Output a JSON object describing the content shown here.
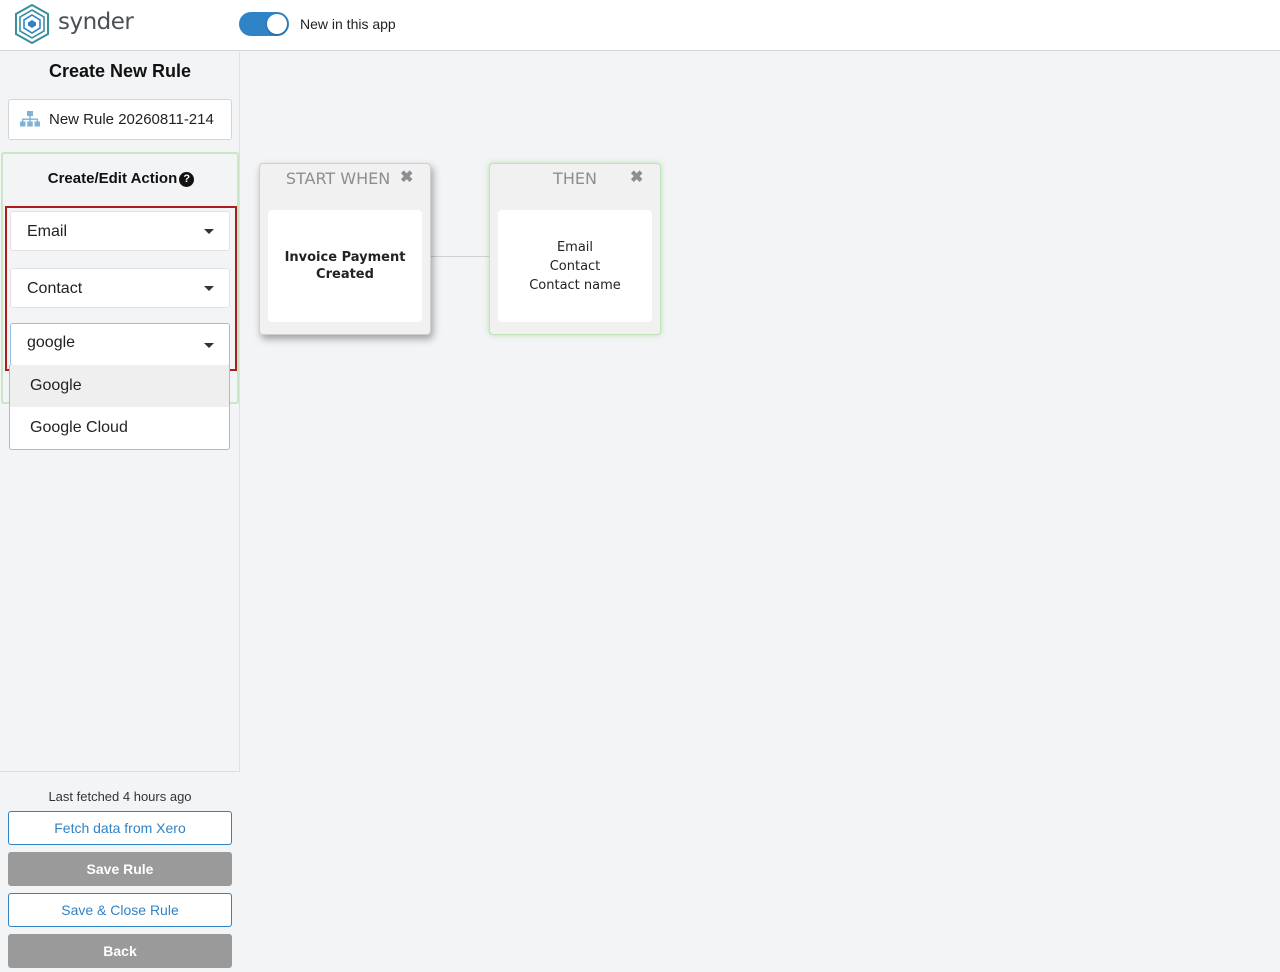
{
  "header": {
    "brand": "synder",
    "toggle_label": "New in this app",
    "toggle_on": true,
    "accent_color": "#2f83c7"
  },
  "sidebar": {
    "title": "Create New Rule",
    "rule_name_value": "New Rule 20260811-214",
    "rule_name_icon": "sitemap-icon",
    "action_panel": {
      "title": "Create/Edit Action",
      "help_icon": "question-circle-icon",
      "selects": [
        {
          "value": "Email"
        },
        {
          "value": "Contact"
        }
      ],
      "search_value": "google",
      "options": [
        "Google",
        "Google Cloud"
      ]
    },
    "footer": {
      "last_fetched": "Last fetched 4 hours ago",
      "fetch_button": "Fetch data from Xero",
      "save_button": "Save Rule",
      "save_close_button": "Save & Close Rule",
      "back_button": "Back"
    }
  },
  "canvas": {
    "start_node": {
      "header": "START WHEN",
      "close_icon": "close-icon",
      "lines": [
        "Invoice Payment",
        "Created"
      ]
    },
    "then_node": {
      "header": "THEN",
      "close_icon": "close-icon",
      "lines": [
        "Email",
        "Contact",
        "Contact name"
      ]
    }
  }
}
